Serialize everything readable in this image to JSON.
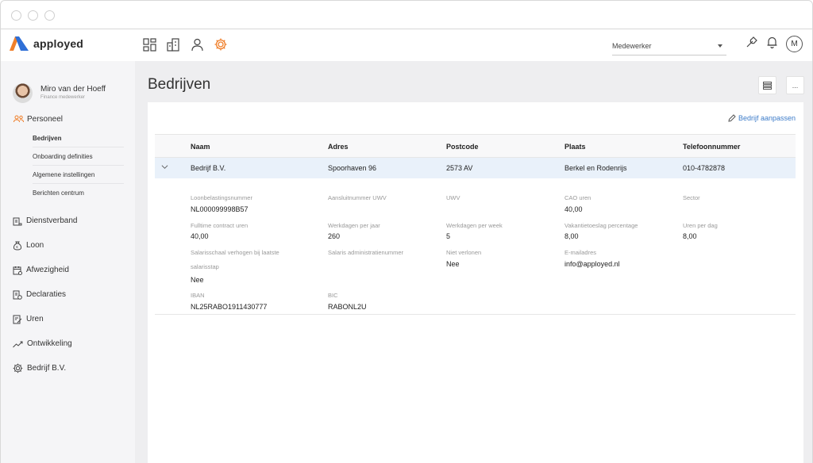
{
  "app": {
    "name": "apployed",
    "brand_colors": {
      "orange": "#f07f2a",
      "blue": "#2f6fd6",
      "accent_link": "#3d7cc9"
    }
  },
  "topbar": {
    "nav_icons": [
      "dashboard-icon",
      "buildings-icon",
      "person-icon",
      "gear-icon"
    ],
    "role_select": "Medewerker",
    "right_icons": [
      "wrench-icon",
      "bell-icon"
    ],
    "avatar_initial": "M"
  },
  "user": {
    "name": "Miro van der Hoeff",
    "role": "Finance medewerker"
  },
  "sidebar": {
    "section": "Personeel",
    "sub_items": [
      "Bedrijven",
      "Onboarding definities",
      "Algemene instellingen",
      "Berichten centrum"
    ],
    "items": [
      "Dienstverband",
      "Loon",
      "Afwezigheid",
      "Declaraties",
      "Uren",
      "Ontwikkeling",
      "Bedrijf B.V."
    ]
  },
  "page": {
    "title": "Bedrijven",
    "more_label": "...",
    "edit_link": "Bedrijf aanpassen"
  },
  "table": {
    "headers": [
      "Naam",
      "Adres",
      "Postcode",
      "Plaats",
      "Telefoonnummer"
    ],
    "row": [
      "Bedrijf B.V.",
      "Spoorhaven 96",
      "2573 AV",
      "Berkel en Rodenrijs",
      "010-4782878"
    ]
  },
  "details": {
    "loonbelasting_label": "Loonbelastingsnummer",
    "loonbelasting_value": "NL000099998B57",
    "aansluit_label": "Aansluitnummer UWV",
    "uwv_label": "UWV",
    "cao_label": "CAO uren",
    "cao_value": "40,00",
    "sector_label": "Sector",
    "fulltime_label": "Fulltime contract uren",
    "fulltime_value": "40,00",
    "werkdagen_jaar_label": "Werkdagen per jaar",
    "werkdagen_jaar_value": "260",
    "werkdagen_week_label": "Werkdagen per week",
    "werkdagen_week_value": "5",
    "vakantie_label": "Vakantietoeslag percentage",
    "vakantie_value": "8,00",
    "uren_dag_label": "Uren per dag",
    "uren_dag_value": "8,00",
    "salarisschaal_label_1": "Salarisschaal verhogen bij laatste",
    "salarisschaal_label_2": "salarisstap",
    "salarisschaal_value": "Nee",
    "salaris_admin_label": "Salaris administratienummer",
    "niet_verlonen_label": "Niet verlonen",
    "niet_verlonen_value": "Nee",
    "email_label": "E-mailadres",
    "email_value": "info@apployed.nl",
    "iban_label": "IBAN",
    "iban_value": "NL25RABO1911430777",
    "bic_label": "BIC",
    "bic_value": "RABONL2U"
  }
}
